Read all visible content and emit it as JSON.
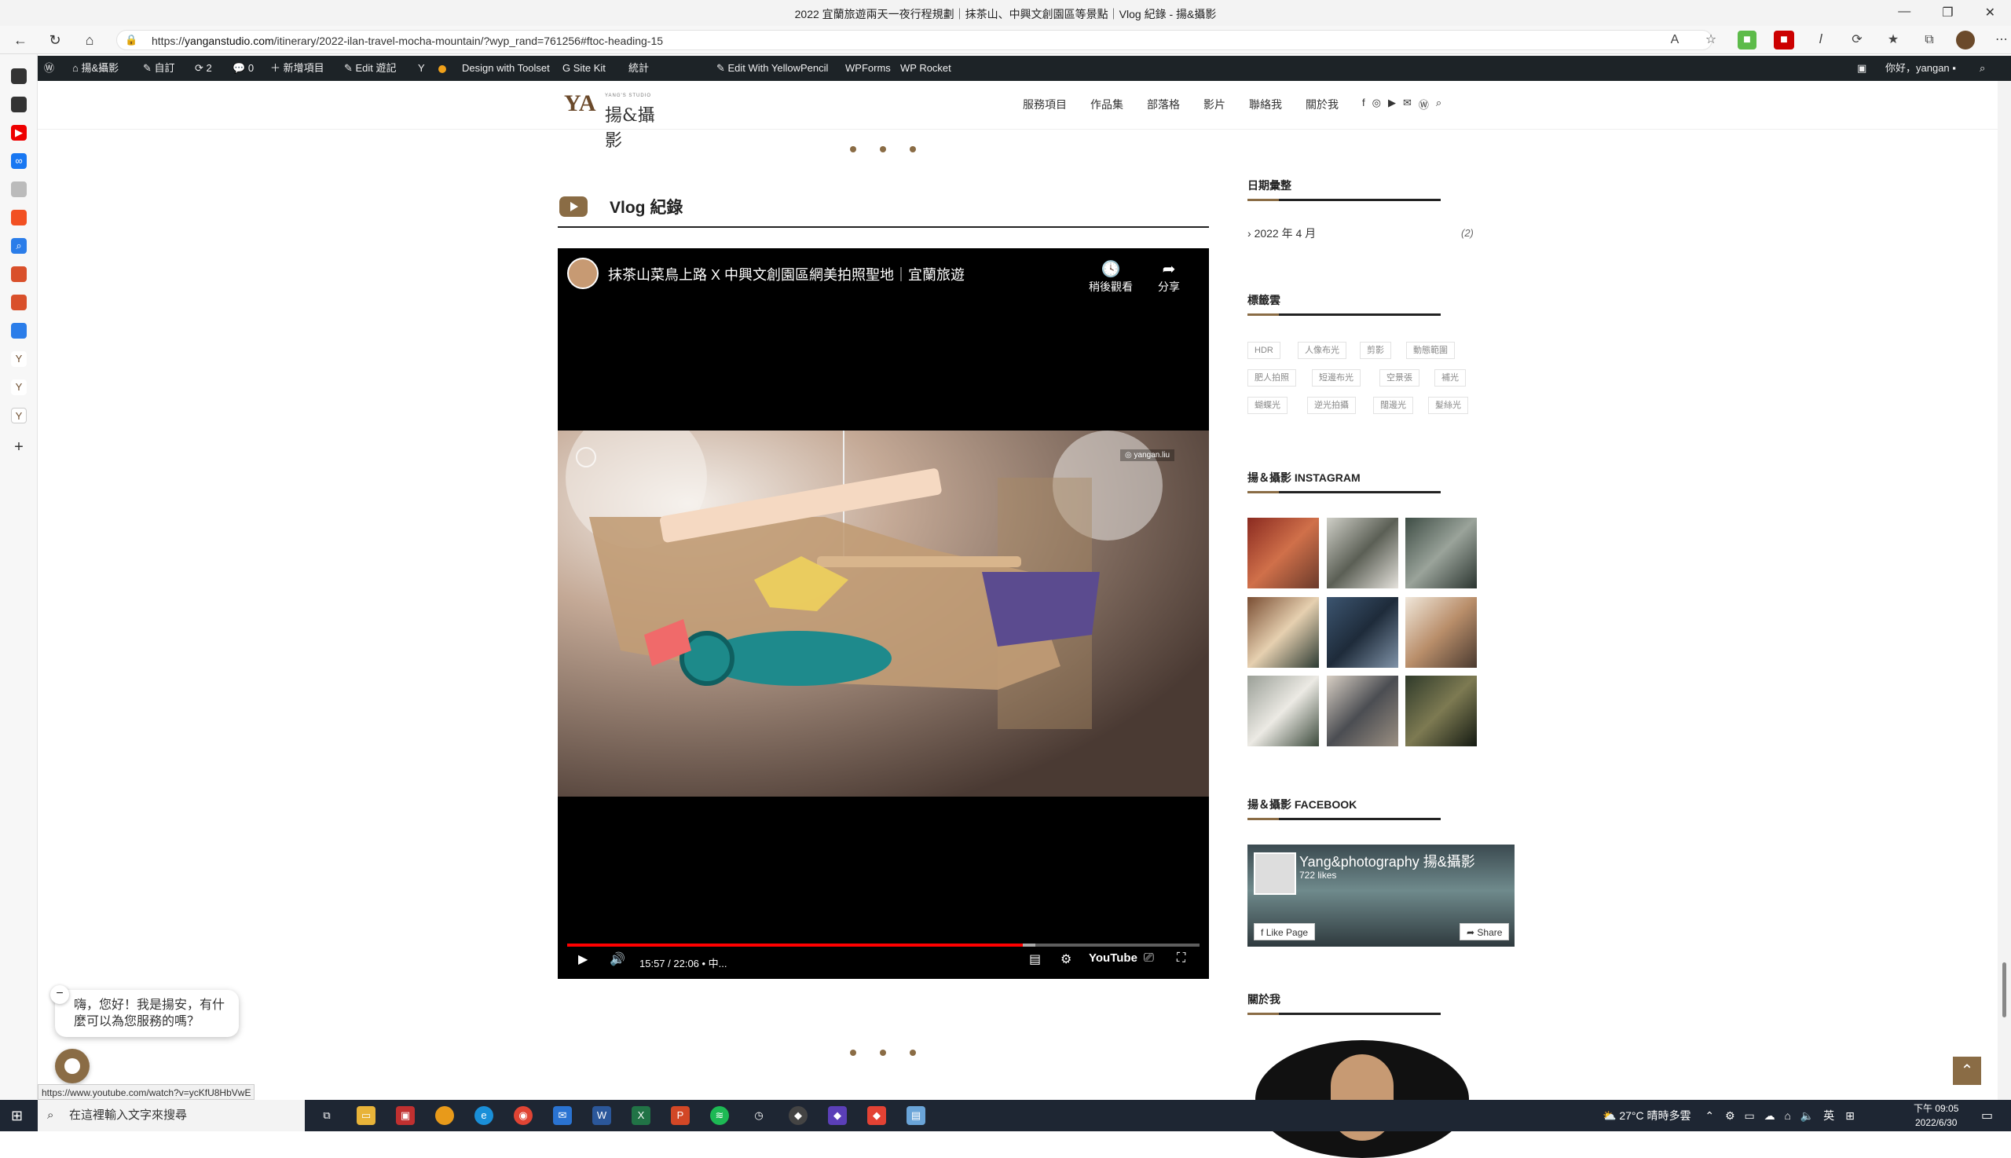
{
  "browser": {
    "title": "2022 宜蘭旅遊兩天一夜行程規劃｜抹茶山、中興文創園區等景點｜Vlog 紀錄 - 揚&攝影",
    "url_prefix": "https://",
    "url_domain": "yanganstudio.com",
    "url_path": "/itinerary/2022-ilan-travel-mocha-mountain/?wyp_rand=761256#ftoc-heading-15",
    "window_buttons": [
      "—",
      "❐",
      "✕"
    ],
    "toolbar_icons": [
      "read-aloud",
      "favorite",
      "extension-green",
      "extension-red",
      "extension-italic",
      "refresh-extension",
      "favorites",
      "collections",
      "profile",
      "more"
    ]
  },
  "wp_admin_bar": {
    "site_name": "揚&攝影",
    "customize": "自訂",
    "updates": "2",
    "comments": "0",
    "new_item": "新增項目",
    "edit_post": "Edit 遊記",
    "design_toolset": "Design with Toolset",
    "site_kit": "Site Kit",
    "stats": "統計",
    "yellowpencil": "Edit With YellowPencil",
    "wpforms": "WPForms",
    "wprocket": "WP Rocket",
    "greeting": "你好，yangan"
  },
  "site": {
    "logo_small": "YANG'S STUDIO",
    "logo_name": "揚&攝影",
    "nav": [
      "服務項目",
      "作品集",
      "部落格",
      "影片",
      "聯絡我",
      "關於我"
    ],
    "social_icons": [
      "facebook-icon",
      "instagram-icon",
      "youtube-icon",
      "email-icon",
      "wordpress-icon",
      "search-icon"
    ]
  },
  "content": {
    "section_title": "Vlog 紀錄",
    "video": {
      "title": "抹茶山菜鳥上路 X 中興文創園區網美拍照聖地｜宜蘭旅遊",
      "watch_later": "稍後觀看",
      "share": "分享",
      "watermark": "yangan.liu",
      "time": "15:57 / 22:06 • 中...",
      "played_fraction": 0.72,
      "loaded_fraction": 0.74,
      "youtube_logo": "YouTube"
    }
  },
  "sidebar": {
    "archive_title": "日期彙整",
    "archive_item": "2022 年 4 月",
    "archive_count": "(2)",
    "tags_title": "標籤雲",
    "tags": [
      "HDR",
      "人像布光",
      "剪影",
      "動態範圍",
      "肥人拍照",
      "短邊布光",
      "空景張",
      "補光",
      "蝴蝶光",
      "逆光拍攝",
      "闊邊光",
      "髮絲光"
    ],
    "instagram_title": "揚＆攝影 INSTAGRAM",
    "facebook_title": "揚＆攝影 FACEBOOK",
    "fb_page_name": "Yang&photography 揚&攝影",
    "fb_likes": "722 likes",
    "fb_like_page": "Like Page",
    "fb_share": "Share",
    "about_title": "關於我"
  },
  "chat": {
    "message": "嗨，您好！我是揚安，有什麼可以為您服務的嗎？",
    "close": "−"
  },
  "status_link": "https://www.youtube.com/watch?v=ycKfU8HbVwE",
  "taskbar": {
    "search_placeholder": "在這裡輸入文字來搜尋",
    "weather": "27°C  晴時多雲",
    "ime": "英",
    "time": "下午 09:05",
    "date": "2022/6/30"
  },
  "colors": {
    "accent": "#8a6c45",
    "wpbar": "#1d2327",
    "youtube_red": "#ff0000"
  }
}
